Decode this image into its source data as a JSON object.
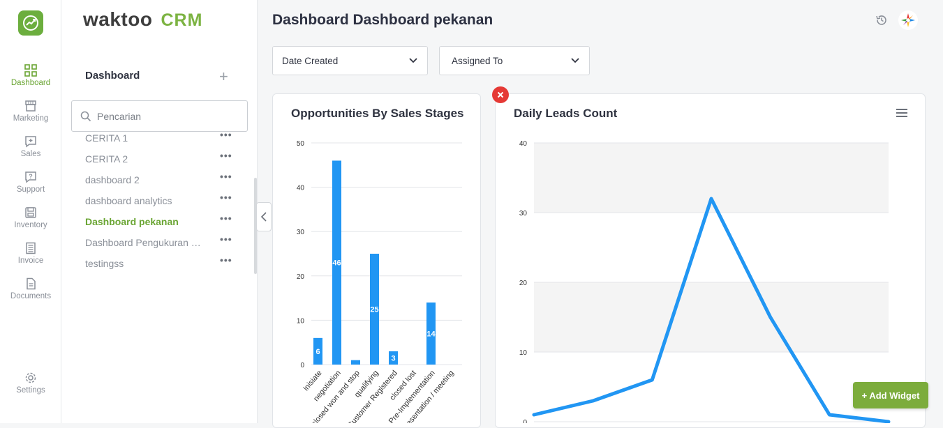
{
  "brand": {
    "word": "waktoo",
    "product": "CRM"
  },
  "rail": {
    "items": [
      {
        "label": "Dashboard",
        "icon": "grid-icon",
        "active": true
      },
      {
        "label": "Marketing",
        "icon": "storefront-icon"
      },
      {
        "label": "Sales",
        "icon": "add-box-icon"
      },
      {
        "label": "Support",
        "icon": "help-box-icon"
      },
      {
        "label": "Inventory",
        "icon": "save-icon"
      },
      {
        "label": "Invoice",
        "icon": "list-doc-icon"
      },
      {
        "label": "Documents",
        "icon": "document-icon"
      }
    ],
    "settings_label": "Settings"
  },
  "panel": {
    "title": "Dashboard",
    "add_symbol": "+",
    "search_placeholder": "Pencarian",
    "item_menu": "•••",
    "items": [
      {
        "label": "CERITA 1"
      },
      {
        "label": "CERITA 2"
      },
      {
        "label": "dashboard 2"
      },
      {
        "label": "dashboard analytics"
      },
      {
        "label": "Dashboard pekanan",
        "active": true
      },
      {
        "label": "Dashboard Pengukuran Kinerja"
      },
      {
        "label": "testingss"
      }
    ]
  },
  "header": {
    "title": "Dashboard Dashboard pekanan"
  },
  "filters": {
    "date_created": "Date Created",
    "assigned_to": "Assigned To"
  },
  "widgets": {
    "opportunities_title": "Opportunities By Sales Stages",
    "leads_title": "Daily Leads Count",
    "add_widget": "+ Add Widget"
  },
  "colors": {
    "accent": "#6aa533",
    "bar": "#2196f3",
    "close": "#e53935",
    "button": "#7cac3c"
  },
  "chart_data": [
    {
      "type": "bar",
      "title": "Opportunities By Sales Stages",
      "categories": [
        "inisiate",
        "negotiation",
        "closed won and stop",
        "qualifying",
        "Customer Registered",
        "closed lost",
        "Pre-Implementation",
        "presentation / meeting"
      ],
      "values": [
        6,
        46,
        1,
        25,
        3,
        0,
        14,
        0
      ],
      "data_labels": [
        "6",
        "46",
        "",
        "25",
        "3",
        "",
        "14",
        ""
      ],
      "ylim": [
        0,
        50
      ],
      "yticks": [
        0,
        10,
        20,
        30,
        40,
        50
      ],
      "grid": true
    },
    {
      "type": "line",
      "title": "Daily Leads Count",
      "values": [
        1,
        3,
        6,
        32,
        15,
        1,
        0
      ],
      "ylim": [
        0,
        40
      ],
      "yticks": [
        0,
        10,
        20,
        30,
        40
      ],
      "grid": true
    }
  ]
}
